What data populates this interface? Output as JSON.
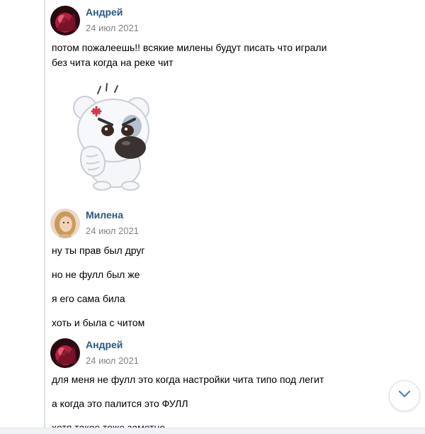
{
  "messages": [
    {
      "author": "Андрей",
      "date": "24 июл 2021",
      "lines": [
        "потом пожалеешь!! всякие милены будут писать что играли",
        "без чита когда на реке чит"
      ],
      "attachment": "bear-sticker"
    },
    {
      "author": "Милена",
      "date": "24 июл 2021",
      "lines": [
        "ну ты прав был друг",
        "но не фулл был же",
        "я его сама била",
        "хоть и была с читом"
      ]
    },
    {
      "author": "Андрей",
      "date": "24 июл 2021",
      "lines": [
        "для меня не фулл это когда настройки чита типо под легит",
        "а когда это палится это ФУЛЛ",
        "хотя такое тоже заметно"
      ]
    }
  ],
  "icons": {
    "scroll_down": "chevron-down-icon",
    "sticker": "angry-bear-sticker"
  },
  "colors": {
    "author_link": "#2a5885",
    "date": "#828282",
    "accent": "#5181b8"
  }
}
